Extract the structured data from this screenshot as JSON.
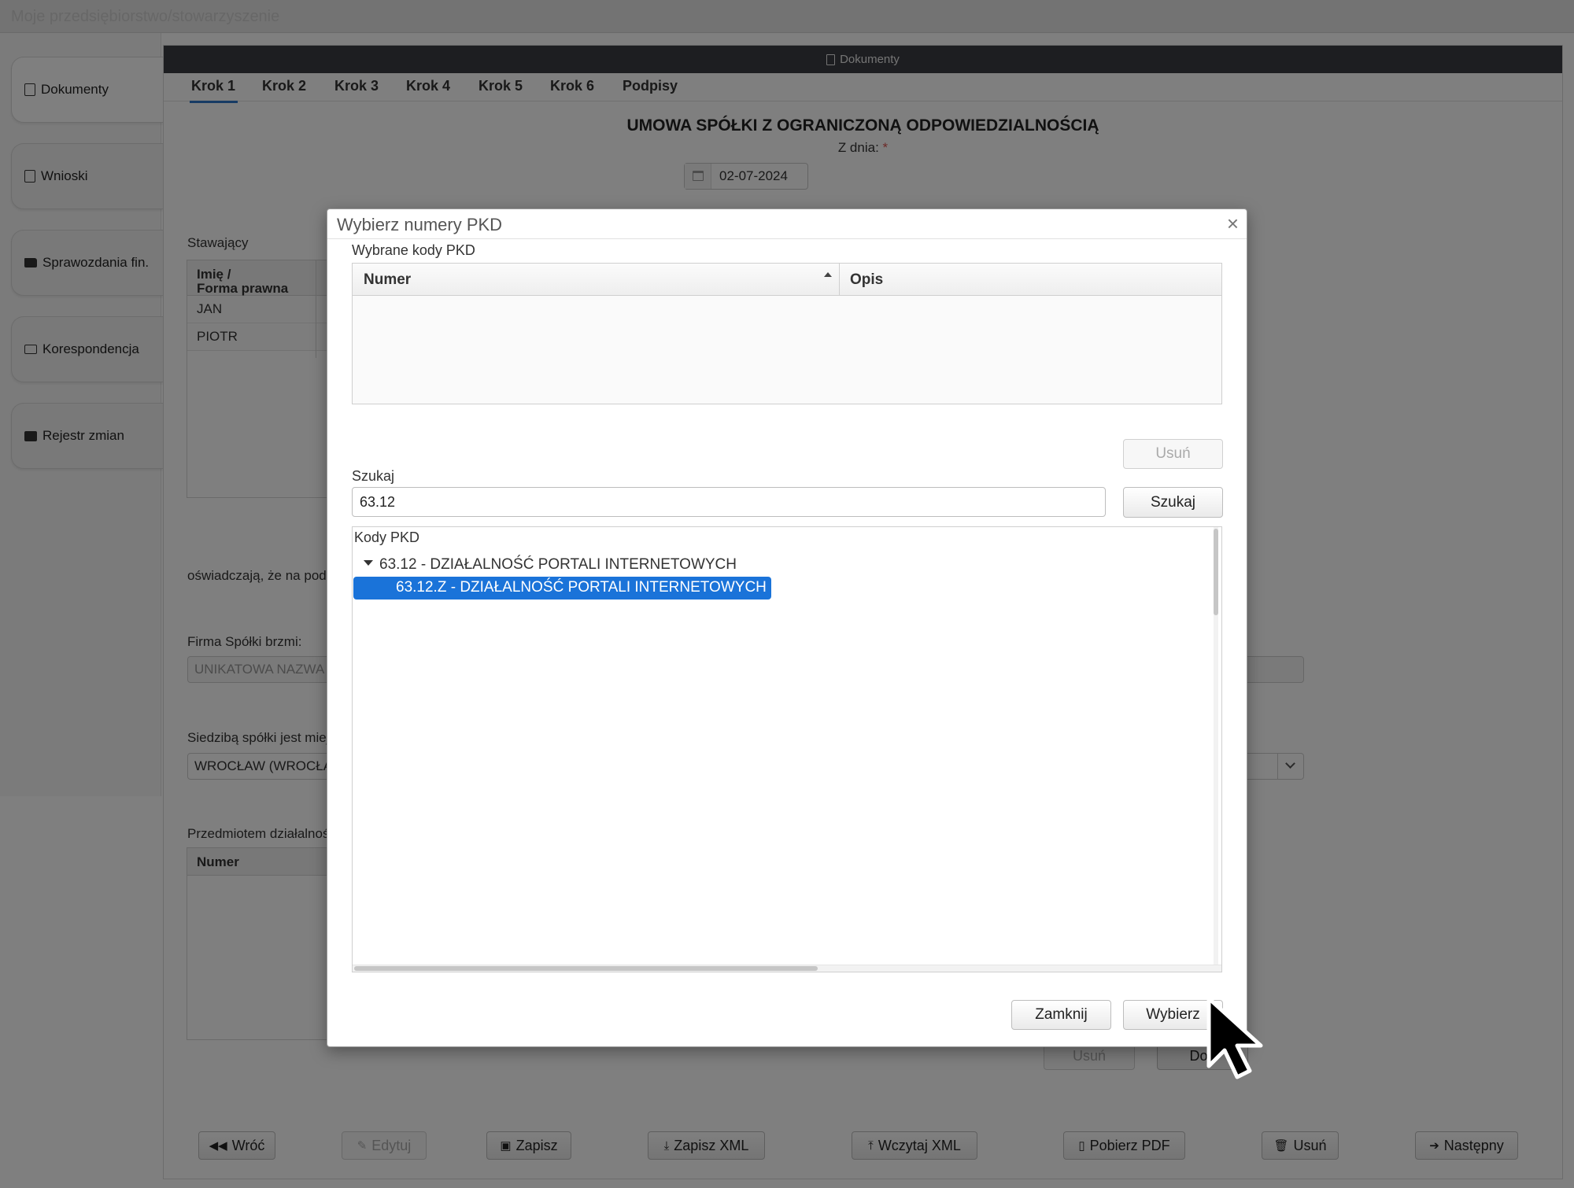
{
  "app": {
    "title": "Moje przedsiębiorstwo/stowarzyszenie"
  },
  "sidebar": {
    "items": [
      {
        "label": "Dokumenty",
        "icon": "document-icon"
      },
      {
        "label": "Wnioski",
        "icon": "upload-document-icon"
      },
      {
        "label": "Sprawozdania fin.",
        "icon": "folder-icon"
      },
      {
        "label": "Korespondencja",
        "icon": "envelope-icon"
      },
      {
        "label": "Rejestr zmian",
        "icon": "briefcase-icon"
      }
    ]
  },
  "panel": {
    "title": "Dokumenty",
    "steps": [
      "Krok 1",
      "Krok 2",
      "Krok 3",
      "Krok 4",
      "Krok 5",
      "Krok 6",
      "Podpisy"
    ],
    "doc_title": "UMOWA SPÓŁKI Z OGRANICZONĄ ODPOWIEDZIALNOŚCIĄ",
    "date_label": "Z dnia:",
    "required_mark": "*",
    "date_value": "02-07-2024",
    "stawajacy_label": "Stawający",
    "stawajacy_header_line1": "Imię /",
    "stawajacy_header_line2": "Forma prawna",
    "stawajacy_rows": [
      "JAN",
      "PIOTR"
    ],
    "oswiadczaja_text": "oświadczają, że na pod",
    "firma_label": "Firma Spółki brzmi:",
    "firma_value": "UNIKATOWA NAZWA",
    "siedziba_label": "Siedzibą spółki jest miej",
    "siedziba_value": "WROCŁAW (WROCŁA",
    "przedmiot_label": "Przedmiotem działalnoś",
    "pkd_table_header": "Numer",
    "pkd_remove_button": "Usuń",
    "pkd_add_button": "Dod",
    "footer_buttons": {
      "back": "Wróć",
      "edit": "Edytuj",
      "save": "Zapisz",
      "save_xml": "Zapisz XML",
      "load_xml": "Wczytaj XML",
      "pdf": "Pobierz PDF",
      "delete": "Usuń",
      "next": "Następny"
    }
  },
  "modal": {
    "title": "Wybierz numery PKD",
    "close_symbol": "×",
    "selected_label": "Wybrane kody PKD",
    "columns": [
      "Numer",
      "Opis"
    ],
    "remove_button": "Usuń",
    "search_label": "Szukaj",
    "search_value": "63.12",
    "search_button": "Szukaj",
    "tree_label": "Kody PKD",
    "tree_parent": "63.12 - DZIAŁALNOŚĆ PORTALI INTERNETOWYCH",
    "tree_child_selected": "63.12.Z - DZIAŁALNOŚĆ PORTALI INTERNETOWYCH",
    "close_button": "Zamknij",
    "select_button": "Wybierz"
  },
  "colors": {
    "accent": "#1a73d9",
    "panel_header": "#3a3d43",
    "required": "#d9534f"
  }
}
